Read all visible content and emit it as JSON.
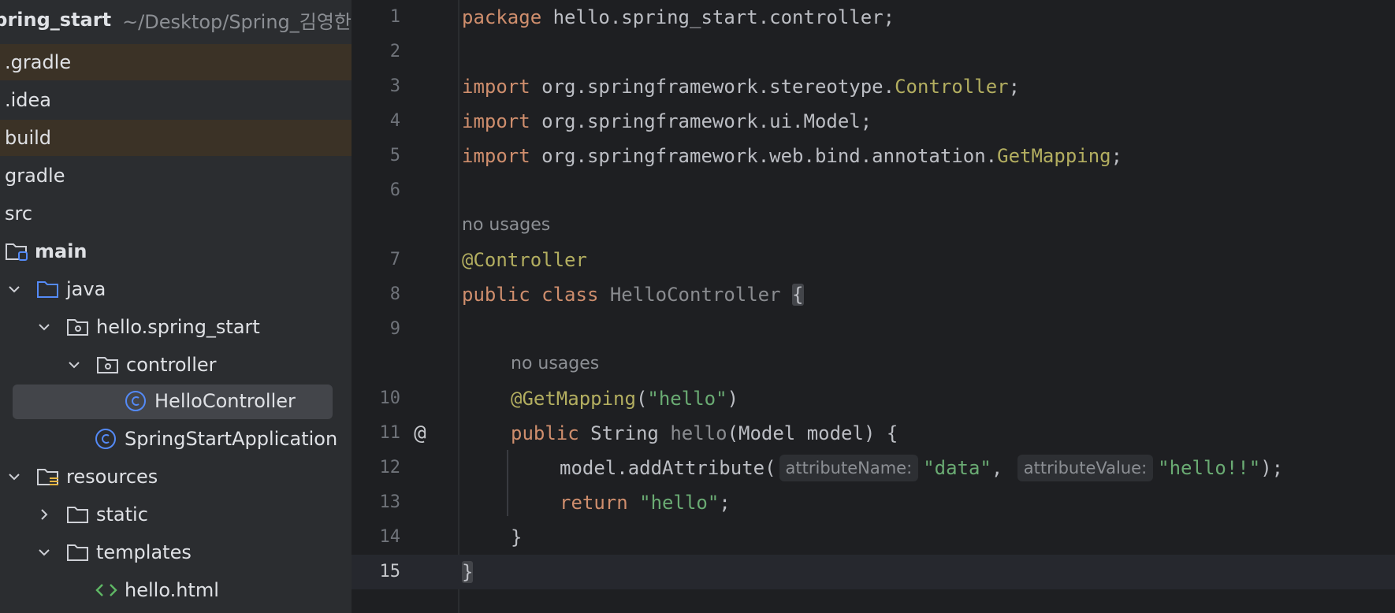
{
  "tree": {
    "root": {
      "name": "spring_start",
      "path": "~/Desktop/Spring_김영한/s"
    },
    "items": [
      {
        "label": ".gradle"
      },
      {
        "label": ".idea"
      },
      {
        "label": "build"
      },
      {
        "label": "gradle"
      },
      {
        "label": "src"
      },
      {
        "label": "main"
      },
      {
        "label": "java"
      },
      {
        "label": "hello.spring_start"
      },
      {
        "label": "controller"
      },
      {
        "label": "HelloController"
      },
      {
        "label": "SpringStartApplication"
      },
      {
        "label": "resources"
      },
      {
        "label": "static"
      },
      {
        "label": "templates"
      },
      {
        "label": "hello.html"
      }
    ]
  },
  "editor": {
    "line_numbers": [
      "1",
      "2",
      "3",
      "4",
      "5",
      "6",
      "7",
      "8",
      "9",
      "10",
      "11",
      "12",
      "13",
      "14",
      "15"
    ],
    "usage_hint": "no usages",
    "tokens": {
      "package_kw": "package",
      "package_name": "hello.spring_start.controller;",
      "import_kw": "import",
      "imp1_pkg": "org.springframework.stereotype.",
      "imp1_cls": "Controller",
      "imp2": "org.springframework.ui.Model;",
      "imp3_pkg": "org.springframework.web.bind.annotation.",
      "imp3_cls": "GetMapping",
      "semicolon": ";",
      "controller_ann": "@Controller",
      "public_class": "public class",
      "class_name": "HelloController",
      "open_brace": "{",
      "getmapping_ann": "@GetMapping",
      "getmapping_arg": "\"hello\"",
      "public_kw": "public",
      "string_type": "String",
      "method_name": "hello",
      "params": "(Model model) {",
      "add_attr": "model.addAttribute(",
      "hint_name": "attributeName:",
      "arg_data": "\"data\"",
      "comma": ", ",
      "hint_value": "attributeValue:",
      "arg_hello": "\"hello!!\"",
      "close_call": ");",
      "return_kw": "return",
      "return_val": "\"hello\"",
      "close_brace": "}"
    },
    "gutter_icon": "@"
  }
}
